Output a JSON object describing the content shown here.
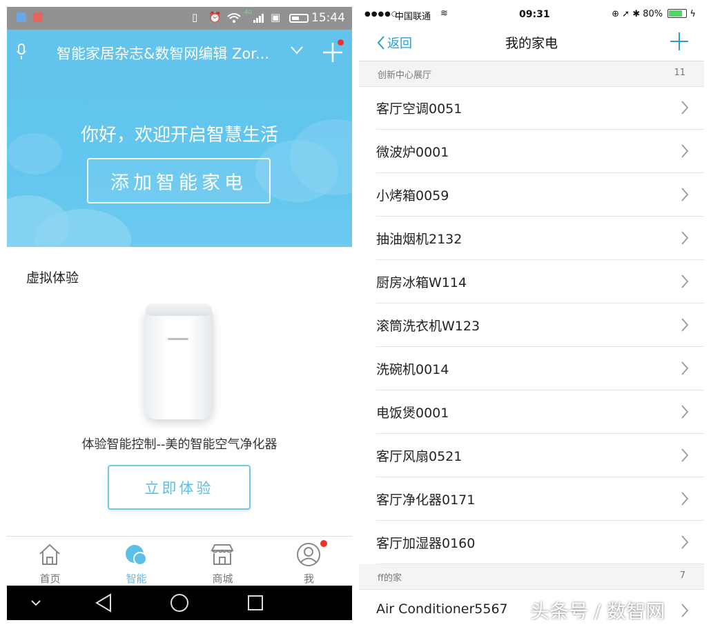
{
  "android": {
    "status": {
      "time": "15:44",
      "net_label": "4G"
    },
    "header": {
      "title": "智能家居杂志&数智网编辑 Zor..."
    },
    "hero": {
      "greeting": "你好，欢迎开启智慧生活",
      "add_button": "添加智能家电"
    },
    "section_title": "虚拟体验",
    "experience": {
      "description": "体验智能控制--美的智能空气净化器",
      "button": "立即体验"
    },
    "tabs": [
      {
        "label": "首页",
        "icon": "home-icon"
      },
      {
        "label": "智能",
        "icon": "smart-cloud-icon"
      },
      {
        "label": "商城",
        "icon": "store-icon"
      },
      {
        "label": "我",
        "icon": "profile-icon"
      }
    ],
    "colors": {
      "accent": "#5bbfe6",
      "hero": "#62c3ec",
      "badge": "#f0302c"
    }
  },
  "ios": {
    "status": {
      "carrier": "中国联通",
      "time": "09:31",
      "battery": "80%"
    },
    "nav": {
      "back_label": "返回",
      "title": "我的家电"
    },
    "groups": [
      {
        "name": "创新中心展厅",
        "count": "11",
        "items": [
          "客厅空调0051",
          "微波炉0001",
          "小烤箱0059",
          "抽油烟机2132",
          "厨房冰箱W114",
          "滚筒洗衣机W123",
          "洗碗机0014",
          "电饭煲0001",
          "客厅风扇0521",
          "客厅净化器0171",
          "客厅加湿器0160"
        ]
      },
      {
        "name": "ff的家",
        "count": "7",
        "items": [
          "Air Conditioner5567"
        ]
      }
    ],
    "colors": {
      "accent": "#2a9cd6"
    }
  },
  "watermark": "头条号 / 数智网"
}
